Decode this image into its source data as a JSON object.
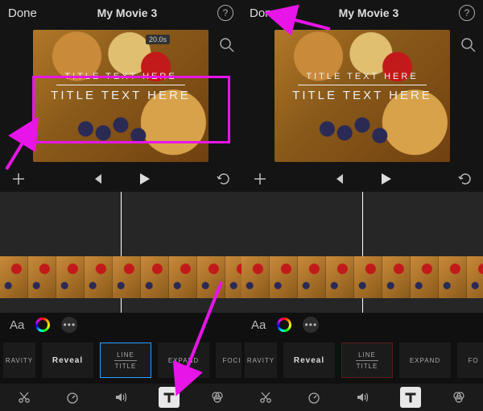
{
  "header": {
    "done_label": "Done",
    "title": "My Movie 3",
    "duration_badge": "20.0s"
  },
  "title_overlay": {
    "line1": "TITLE TEXT HERE",
    "line2": "TITLE TEXT HERE"
  },
  "tools": {
    "font_label": "Aa"
  },
  "title_styles": {
    "items": [
      {
        "label": "RAVITY"
      },
      {
        "label": "Reveal"
      },
      {
        "label_top": "LINE",
        "label_bottom": "TITLE"
      },
      {
        "label": "EXPAND"
      },
      {
        "label": "FOCI"
      }
    ],
    "items_right": [
      {
        "label": "RAVITY"
      },
      {
        "label": "Reveal"
      },
      {
        "label_top": "LINE",
        "label_bottom": "TITLE"
      },
      {
        "label": "EXPAND"
      },
      {
        "label": "FO"
      }
    ]
  },
  "icons": {
    "help": "?",
    "more": "•••"
  }
}
